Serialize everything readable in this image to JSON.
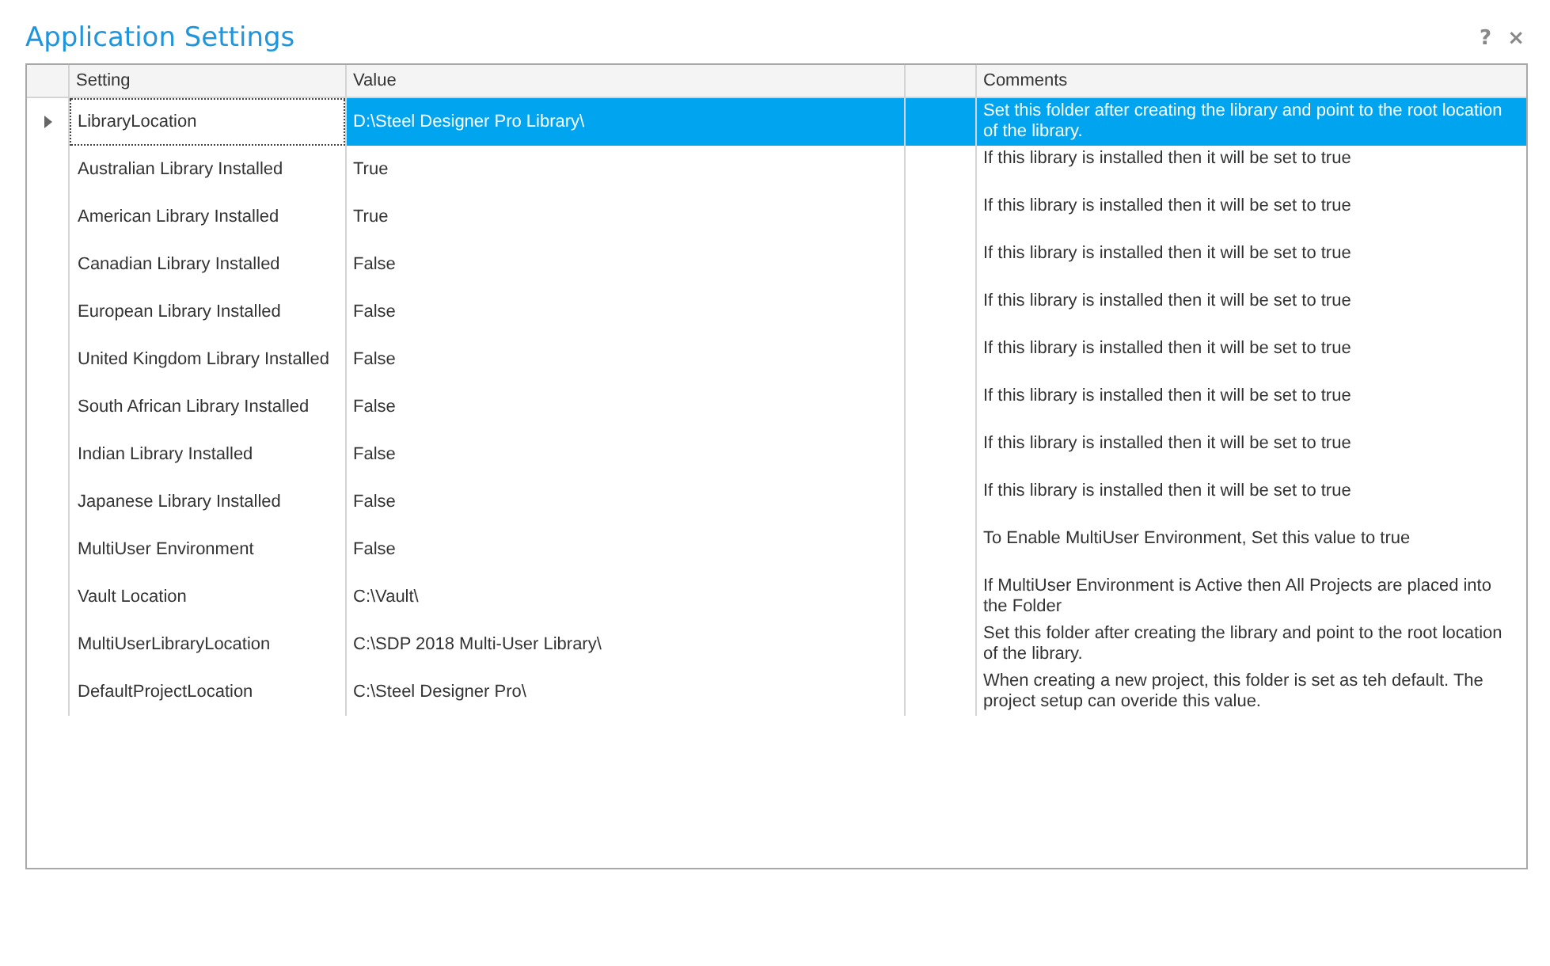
{
  "window": {
    "title": "Application Settings",
    "help": "?",
    "close": "×"
  },
  "table": {
    "columns": [
      "Setting",
      "Value",
      "Comments"
    ],
    "rows": [
      {
        "setting": "LibraryLocation",
        "value": "D:\\Steel Designer Pro Library\\",
        "comment": "Set this folder after creating the library and point to the root location of the library.",
        "selected": true
      },
      {
        "setting": "Australian Library Installed",
        "value": "True",
        "comment": "If this library is installed then it will be set to true",
        "selected": false
      },
      {
        "setting": "American Library Installed",
        "value": "True",
        "comment": "If this library is installed then it will be set to true",
        "selected": false
      },
      {
        "setting": "Canadian Library Installed",
        "value": "False",
        "comment": "If this library is installed then it will be set to true",
        "selected": false
      },
      {
        "setting": "European Library Installed",
        "value": "False",
        "comment": "If this library is installed then it will be set to true",
        "selected": false
      },
      {
        "setting": "United Kingdom Library Installed",
        "value": "False",
        "comment": "If this library is installed then it will be set to true",
        "selected": false
      },
      {
        "setting": "South African Library Installed",
        "value": "False",
        "comment": "If this library is installed then it will be set to true",
        "selected": false
      },
      {
        "setting": "Indian Library Installed",
        "value": "False",
        "comment": "If this library is installed then it will be set to true",
        "selected": false
      },
      {
        "setting": "Japanese Library Installed",
        "value": "False",
        "comment": "If this library is installed then it will be set to true",
        "selected": false
      },
      {
        "setting": "MultiUser Environment",
        "value": "False",
        "comment": "To Enable MultiUser Environment, Set this value to true",
        "selected": false
      },
      {
        "setting": "Vault Location",
        "value": "C:\\Vault\\",
        "comment": "If MultiUser Environment is Active then All Projects are placed into the Folder",
        "selected": false
      },
      {
        "setting": "MultiUserLibraryLocation",
        "value": "C:\\SDP 2018 Multi-User Library\\",
        "comment": "Set this folder after creating the library and point to the root location of the library.",
        "selected": false
      },
      {
        "setting": "DefaultProjectLocation",
        "value": "C:\\Steel Designer Pro\\",
        "comment": "When creating a new project, this folder is set as teh default. The project setup can overide this value.",
        "selected": false
      }
    ]
  }
}
